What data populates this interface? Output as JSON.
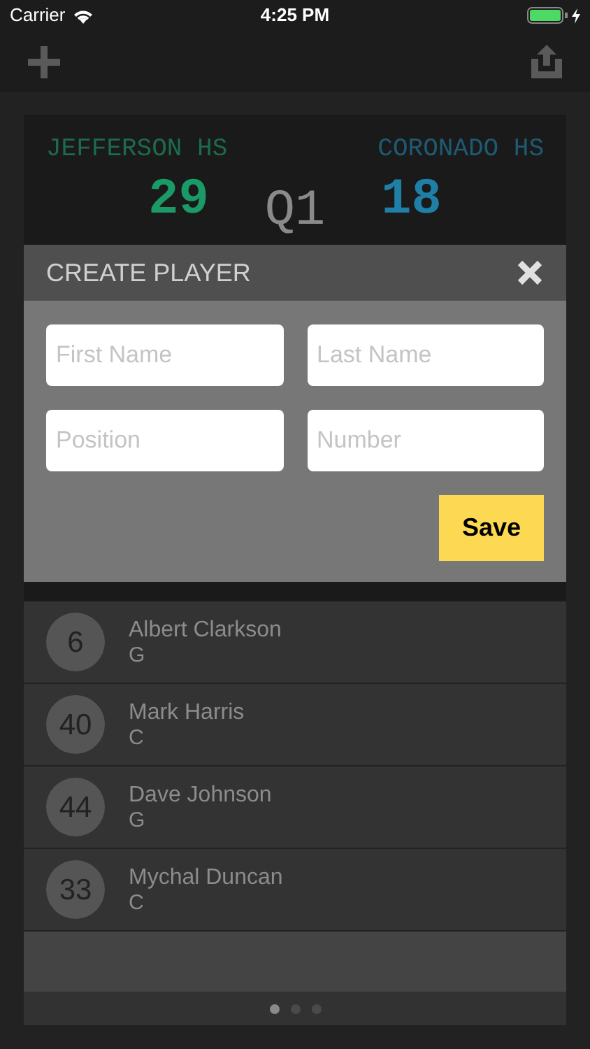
{
  "status_bar": {
    "carrier": "Carrier",
    "time": "4:25 PM"
  },
  "scoreboard": {
    "home_team": "JEFFERSON HS",
    "away_team": "CORONADO HS",
    "home_score": "29",
    "period": "Q1",
    "away_score": "18"
  },
  "dialog": {
    "title": "CREATE PLAYER",
    "fields": [
      {
        "placeholder": "First Name"
      },
      {
        "placeholder": "Last Name"
      },
      {
        "placeholder": "Position"
      },
      {
        "placeholder": "Number"
      }
    ],
    "save_button": "Save"
  },
  "players": [
    {
      "number": "6",
      "name": "Albert Clarkson",
      "position": "G"
    },
    {
      "number": "40",
      "name": "Mark Harris",
      "position": "C"
    },
    {
      "number": "44",
      "name": "Dave Johnson",
      "position": "G"
    },
    {
      "number": "33",
      "name": "Mychal Duncan",
      "position": "C"
    }
  ],
  "pages": [
    {
      "selected": true
    },
    {
      "selected": false
    },
    {
      "selected": false
    }
  ]
}
